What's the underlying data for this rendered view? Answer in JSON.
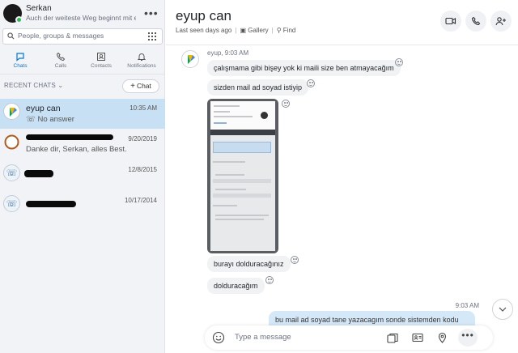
{
  "profile": {
    "name": "Serkan",
    "mood": "Auch der weiteste Weg beginnt mit ei...",
    "more": "•••"
  },
  "search": {
    "placeholder": "People, groups & messages"
  },
  "tabs": [
    {
      "label": "Chats",
      "icon": "chat-icon",
      "active": true
    },
    {
      "label": "Calls",
      "icon": "phone-icon"
    },
    {
      "label": "Contacts",
      "icon": "contacts-icon"
    },
    {
      "label": "Notifications",
      "icon": "bell-icon"
    }
  ],
  "recent": {
    "header": "RECENT CHATS",
    "new_chat": "Chat"
  },
  "chats": [
    {
      "name": "eyup can",
      "time": "10:35 AM",
      "preview": "No answer",
      "avatar": "google-logo-icon",
      "active": true
    },
    {
      "name": "",
      "time": "9/20/2019",
      "preview": "Danke dir, Serkan, alles Best...",
      "avatar": "ring-avatar-icon"
    },
    {
      "name": "",
      "time": "12/8/2015",
      "preview": "",
      "avatar": "phone-avatar-icon"
    },
    {
      "name": "",
      "time": "10/17/2014",
      "preview": "",
      "avatar": "phone-avatar-icon"
    }
  ],
  "conversation": {
    "title": "eyup can",
    "last_seen": "Last seen days ago",
    "gallery": "Gallery",
    "find": "Find",
    "sender_meta": "eyup, 9:03 AM",
    "messages": [
      "çalışmama gibi bişey yok ki maili size ben atmayacağım",
      "sizden mail ad soyad istiyip",
      "burayı dolduracağınız",
      "dolduracağım"
    ],
    "outgoing_time": "9:03 AM",
    "outgoing_text": "bu mail ad soyad tane yazacagım sonde sistemden kodu"
  },
  "composer": {
    "placeholder": "Type a message",
    "more": "•••"
  },
  "colors": {
    "accent": "#0078d4",
    "selected": "#c7e0f4",
    "online": "#2ebd59",
    "outgoing": "#d5e8f7"
  }
}
